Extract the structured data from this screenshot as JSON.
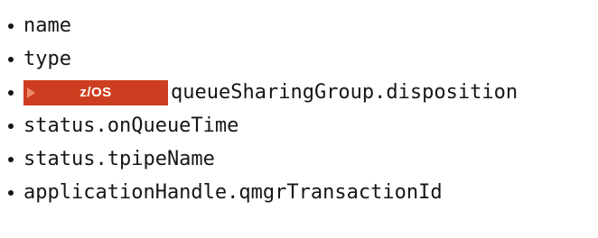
{
  "attributes": [
    {
      "label": "name"
    },
    {
      "label": "type"
    },
    {
      "label": "queueSharingGroup.disposition",
      "badge": {
        "label": "z/OS",
        "color": "#cc3e1f"
      }
    },
    {
      "label": "status.onQueueTime"
    },
    {
      "label": "status.tpipeName"
    },
    {
      "label": "applicationHandle.qmgrTransactionId"
    }
  ]
}
